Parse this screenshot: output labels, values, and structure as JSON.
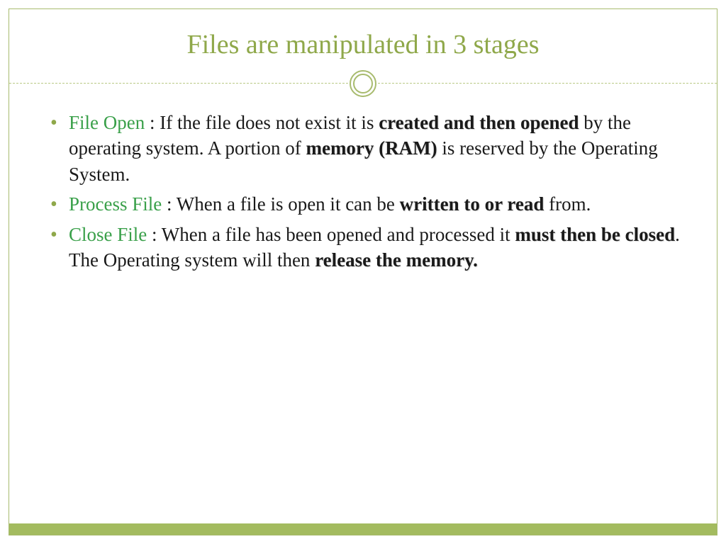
{
  "title": "Files are manipulated in 3 stages",
  "bullets": [
    {
      "term": "File Open",
      "seg1": " : If the file does not exist it is ",
      "bold1": "created and then opened",
      "seg2": " by the operating system. A portion of ",
      "bold2": "memory (RAM)",
      "seg3": " is reserved by the Operating System."
    },
    {
      "term": "Process File",
      "seg1": " : When a file is open it can be ",
      "bold1": "written to or read",
      "seg2": " from.",
      "bold2": "",
      "seg3": ""
    },
    {
      "term": "Close File",
      "seg1": " : When a file has been opened and processed it ",
      "bold1": "must then be closed",
      "seg2": ". The Operating system will then ",
      "bold2": "release the memory.",
      "seg3": ""
    }
  ]
}
